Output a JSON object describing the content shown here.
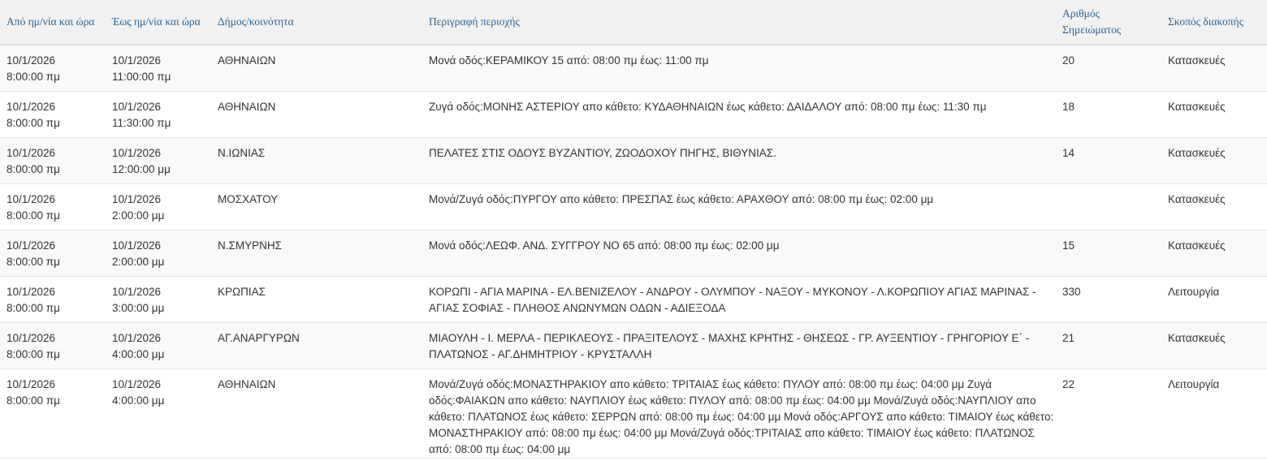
{
  "headers": {
    "from": "Από ημ/νία και ώρα",
    "to": "Έως ημ/νία και ώρα",
    "municipality": "Δήμος/κοινότητα",
    "area": "Περιγραφή περιοχής",
    "number": "Αριθμός\nΣημειώματος",
    "purpose": "Σκοπός διακοπής"
  },
  "rows": [
    {
      "from": "10/1/2026\n8:00:00 πμ",
      "to": "10/1/2026\n11:00:00 πμ",
      "municipality": "ΑΘΗΝΑΙΩΝ",
      "area": "Μονά οδός:ΚΕΡΑΜΙΚΟΥ 15 από: 08:00 πμ έως: 11:00 πμ",
      "number": "20",
      "purpose": "Κατασκευές"
    },
    {
      "from": "10/1/2026\n8:00:00 πμ",
      "to": "10/1/2026\n11:30:00 πμ",
      "municipality": "ΑΘΗΝΑΙΩΝ",
      "area": "Ζυγά οδός:ΜΟΝΗΣ ΑΣΤΕΡΙΟΥ απο κάθετο: ΚΥΔΑΘΗΝΑΙΩΝ έως κάθετο: ΔΑΙΔΑΛΟΥ από: 08:00 πμ έως: 11:30 πμ",
      "number": "18",
      "purpose": "Κατασκευές"
    },
    {
      "from": "10/1/2026\n8:00:00 πμ",
      "to": "10/1/2026\n12:00:00 μμ",
      "municipality": "Ν.ΙΩΝΙΑΣ",
      "area": "ΠΕΛΑΤΕΣ ΣΤΙΣ ΟΔΟΥΣ ΒΥΖΑΝΤΙΟΥ, ΖΩΟΔΟΧΟΥ ΠΗΓΗΣ, ΒΙΘΥΝΙΑΣ.",
      "number": "14",
      "purpose": "Κατασκευές"
    },
    {
      "from": "10/1/2026\n8:00:00 πμ",
      "to": "10/1/2026\n2:00:00 μμ",
      "municipality": "ΜΟΣΧΑΤΟΥ",
      "area": "Μονά/Ζυγά οδός:ΠΥΡΓΟΥ απο κάθετο: ΠΡΕΣΠΑΣ έως κάθετο: ΑΡΑΧΘΟΥ από: 08:00 πμ έως: 02:00 μμ",
      "number": "",
      "purpose": "Κατασκευές"
    },
    {
      "from": "10/1/2026\n8:00:00 πμ",
      "to": "10/1/2026\n2:00:00 μμ",
      "municipality": "Ν.ΣΜΥΡΝΗΣ",
      "area": "Μονά οδός:ΛΕΩΦ. ΑΝΔ. ΣΥΓΓΡΟΥ ΝΟ 65 από: 08:00 πμ έως: 02:00 μμ",
      "number": "15",
      "purpose": "Κατασκευές"
    },
    {
      "from": "10/1/2026\n8:00:00 πμ",
      "to": "10/1/2026\n3:00:00 μμ",
      "municipality": "ΚΡΩΠΙΑΣ",
      "area": "ΚΟΡΩΠΙ - ΑΓΙΑ ΜΑΡΙΝΑ - ΕΛ.ΒΕΝΙΖΕΛΟΥ - ΑΝΔΡΟΥ - ΟΛΥΜΠΟΥ - ΝΑΞΟΥ - ΜΥΚΟΝΟΥ - Λ.ΚΟΡΩΠΙΟΥ ΑΓΙΑΣ ΜΑΡΙΝΑΣ - ΑΓΙΑΣ ΣΟΦΙΑΣ - ΠΛΗΘΟΣ ΑΝΩΝΥΜΩΝ ΟΔΩΝ - ΑΔΙΕΞΟΔΑ",
      "number": "330",
      "purpose": "Λειτουργία"
    },
    {
      "from": "10/1/2026\n8:00:00 πμ",
      "to": "10/1/2026\n4:00:00 μμ",
      "municipality": "ΑΓ.ΑΝΑΡΓΥΡΩΝ",
      "area": "ΜΙΑΟΥΛΗ - Ι. ΜΕΡΛΑ - ΠΕΡΙΚΛΕΟΥΣ - ΠΡΑΞΙΤΕΛΟΥΣ - ΜΑΧΗΣ ΚΡΗΤΗΣ - ΘΗΣΕΩΣ - ΓΡ. ΑΥΞΕΝΤΙΟΥ - ΓΡΗΓΟΡΙΟΥ Ε΄ - ΠΛΑΤΩΝΟΣ - ΑΓ.ΔΗΜΗΤΡΙΟΥ - ΚΡΥΣΤΑΛΛΗ",
      "number": "21",
      "purpose": "Κατασκευές"
    },
    {
      "from": "10/1/2026\n8:00:00 πμ",
      "to": "10/1/2026\n4:00:00 μμ",
      "municipality": "ΑΘΗΝΑΙΩΝ",
      "area": "Μονά/Ζυγά οδός:ΜΟΝΑΣΤΗΡΑΚΙΟΥ απο κάθετο: ΤΡΙΤΑΙΑΣ έως κάθετο: ΠΥΛΟΥ από: 08:00 πμ έως: 04:00 μμ Ζυγά οδός:ΦΑΙΑΚΩΝ απο κάθετο: ΝΑΥΠΛΙΟΥ έως κάθετο: ΠΥΛΟΥ από: 08:00 πμ έως: 04:00 μμ Μονά/Ζυγά οδός:ΝΑΥΠΛΙΟΥ απο κάθετο: ΠΛΑΤΩΝΟΣ έως κάθετο: ΣΕΡΡΩΝ από: 08:00 πμ έως: 04:00 μμ Μονά οδός:ΑΡΓΟΥΣ απο κάθετο: ΤΙΜΑΙΟΥ έως κάθετο: ΜΟΝΑΣΤΗΡΑΚΙΟΥ από: 08:00 πμ έως: 04:00 μμ Μονά/Ζυγά οδός:ΤΡΙΤΑΙΑΣ απο κάθετο: ΤΙΜΑΙΟΥ έως κάθετο: ΠΛΑΤΩΝΟΣ από: 08:00 πμ έως: 04:00 μμ",
      "number": "22",
      "purpose": "Λειτουργία"
    }
  ]
}
